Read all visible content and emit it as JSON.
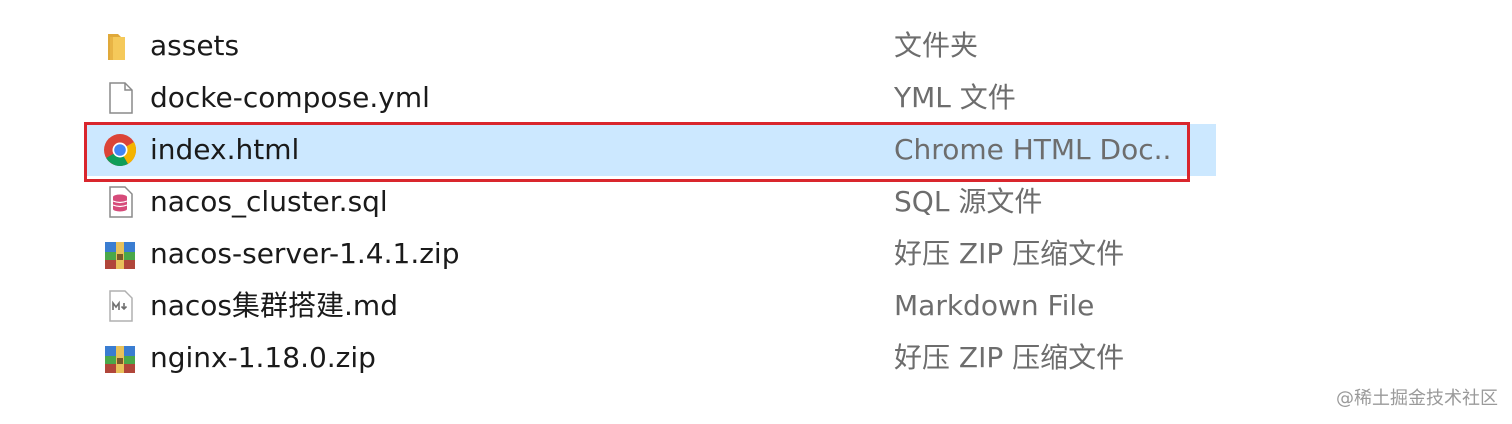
{
  "files": [
    {
      "name": "assets",
      "type": "文件夹",
      "icon": "folder-icon",
      "selected": false
    },
    {
      "name": "docke-compose.yml",
      "type": "YML 文件",
      "icon": "document-icon",
      "selected": false
    },
    {
      "name": "index.html",
      "type": "Chrome HTML Doc..",
      "icon": "chrome-icon",
      "selected": true
    },
    {
      "name": "nacos_cluster.sql",
      "type": "SQL 源文件",
      "icon": "sql-file-icon",
      "selected": false
    },
    {
      "name": "nacos-server-1.4.1.zip",
      "type": "好压 ZIP 压缩文件",
      "icon": "zip-archive-icon",
      "selected": false
    },
    {
      "name": "nacos集群搭建.md",
      "type": "Markdown File",
      "icon": "markdown-file-icon",
      "selected": false
    },
    {
      "name": "nginx-1.18.0.zip",
      "type": "好压 ZIP 压缩文件",
      "icon": "zip-archive-icon",
      "selected": false
    }
  ],
  "watermark": "@稀土掘金技术社区",
  "colors": {
    "selection": "#cce8ff",
    "highlight_border": "#d9262d",
    "name_text": "#1a1a1a",
    "type_text": "#6d6d6d"
  }
}
